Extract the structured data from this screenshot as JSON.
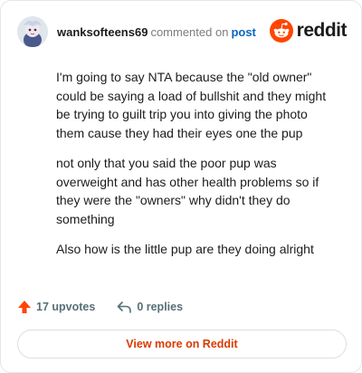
{
  "header": {
    "username": "wanksofteens69",
    "action_text": "commented on",
    "post_link": "post",
    "brand": "reddit"
  },
  "comment": {
    "paragraphs": [
      "I'm going to say NTA because the \"old owner\" could be saying a load of bullshit and they might be trying to guilt trip you into giving the photo them cause they had their eyes one the pup",
      "not only that you said the poor pup was overweight and has other health problems so if they were the \"owners\" why didn't they do something",
      "Also how is the little pup are they doing alright"
    ]
  },
  "footer": {
    "upvotes": "17 upvotes",
    "replies": "0 replies",
    "view_more": "View more on Reddit"
  },
  "colors": {
    "brand_orange": "#ff4500",
    "link_blue": "#0a66c2",
    "view_more_text": "#d93a00"
  },
  "icons": {
    "avatar": "avatar-image",
    "logo": "reddit-snoo-icon",
    "upvote": "upvote-arrow-icon",
    "reply": "reply-arrow-icon"
  }
}
